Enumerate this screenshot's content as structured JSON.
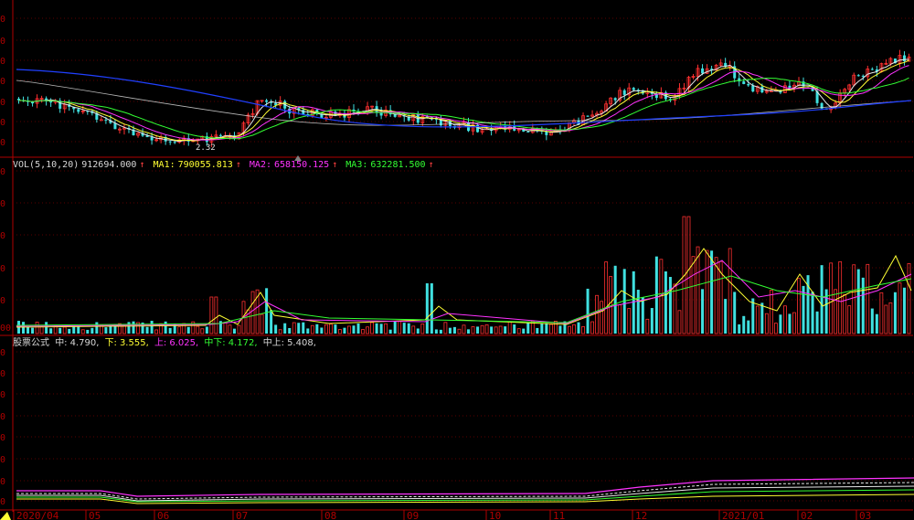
{
  "colors": {
    "background": "#000000",
    "frame": "#b00000",
    "grid": "#5a0000",
    "up": "#ff3030",
    "down": "#40e0e0",
    "text": "#d8d8d8",
    "ma_white": "#e8e8e8",
    "ma_yellow": "#ffff33",
    "ma_magenta": "#ff33ff",
    "ma_green": "#33ff33",
    "ma_blue": "#2040ff"
  },
  "price_panel": {
    "low_marker": "2.32",
    "tick_labels": [
      "0",
      "0",
      "0",
      "0",
      "0",
      "0",
      "0"
    ]
  },
  "volume_panel": {
    "label": "VOL(5,10,20)",
    "value": "912694.000",
    "ma1_label": "MA1:",
    "ma1_value": "790055.813",
    "ma1_arrow": "↑",
    "ma2_label": "MA2:",
    "ma2_value": "658150.125",
    "ma2_arrow": "↑",
    "ma3_label": "MA3:",
    "ma3_value": "632281.500",
    "ma3_arrow": "↑",
    "tick_labels": [
      "0",
      "0",
      "0",
      "0",
      "0",
      "00"
    ]
  },
  "indicator_panel": {
    "name": "股票公式",
    "mid_label": "中:",
    "mid_value": "4.790,",
    "low_label": "下:",
    "low_value": "3.555,",
    "up_label": "上:",
    "up_value": "6.025,",
    "midlow_label": "中下:",
    "midlow_value": "4.172,",
    "midup_label": "中上:",
    "midup_value": "5.408,",
    "tick_labels": [
      "0",
      "0",
      "0",
      "0",
      "0",
      "0",
      "0",
      "0"
    ]
  },
  "x_axis": {
    "labels": [
      "2020/04",
      "05",
      "06",
      "07",
      "08",
      "09",
      "10",
      "11",
      "12",
      "2021/01",
      "02",
      "03"
    ]
  }
}
